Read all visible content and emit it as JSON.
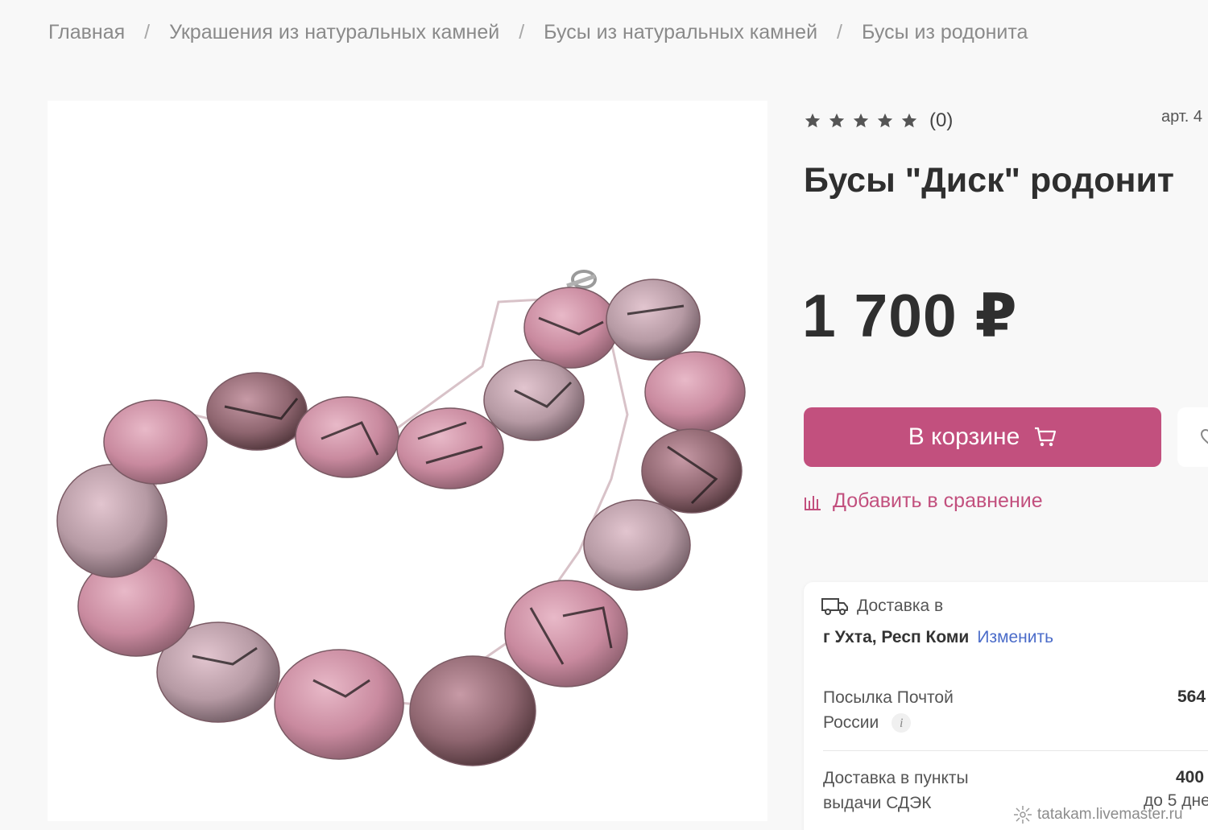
{
  "breadcrumb": {
    "items": [
      "Главная",
      "Украшения из натуральных камней",
      "Бусы из натуральных камней",
      "Бусы из родонита"
    ],
    "separator": "/"
  },
  "product": {
    "rating_stars": 5,
    "rating_count": "(0)",
    "article_label": "арт. 4",
    "title": "Бусы \"Диск\" родонит",
    "price": "1 700 ₽"
  },
  "actions": {
    "cart_button_label": "В корзине",
    "compare_label": "Добавить в сравнение"
  },
  "delivery": {
    "header": "Доставка в",
    "city": "г Ухта, Респ Коми",
    "change_label": "Изменить",
    "options": [
      {
        "name_line1": "Посылка Почтой",
        "name_line2": "России",
        "price": "564",
        "days": ""
      },
      {
        "name_line1": "Доставка в пункты",
        "name_line2": "выдачи СДЭК",
        "price": "400",
        "days": "до 5 дне"
      }
    ]
  },
  "watermark": "tatakam.livemaster.ru",
  "colors": {
    "accent": "#c2507e",
    "link": "#4b6cc9",
    "background": "#f8f8f8"
  }
}
